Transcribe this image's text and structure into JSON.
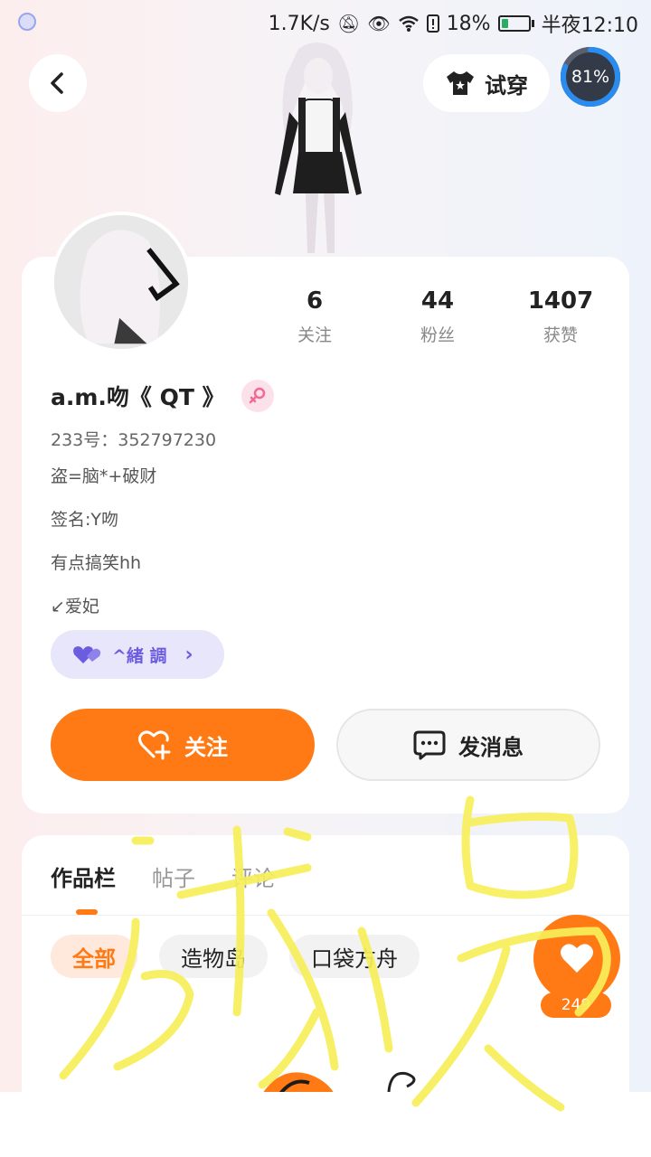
{
  "status_bar": {
    "network_speed": "1.7K/s",
    "battery_percent": "18%",
    "time": "半夜12:10"
  },
  "header": {
    "tryon_label": "试穿",
    "progress_label": "81%",
    "progress_value": 0.81
  },
  "profile": {
    "stats": [
      {
        "value": "6",
        "label": "关注"
      },
      {
        "value": "44",
        "label": "粉丝"
      },
      {
        "value": "1407",
        "label": "获赞"
      }
    ],
    "username": "a.m.吻《 QT 》",
    "account_id": "233号：352797230",
    "bio": [
      "盗=脑*+破财",
      "签名:Y吻",
      "有点搞笑hh",
      "↙爱妃"
    ],
    "tag_label": "^緒 調",
    "follow_label": "关注",
    "message_label": "发消息"
  },
  "content": {
    "tabs": [
      "作品栏",
      "帖子",
      "评论"
    ],
    "active_tab": 0,
    "filters": [
      "全部",
      "造物岛",
      "口袋方舟"
    ],
    "active_filter": 0,
    "like_count": "249"
  },
  "colors": {
    "accent": "#ff7a14",
    "tag": "#6b5ce0",
    "scribble": "#f7ef5a"
  },
  "icons": {
    "back": "chevron-left-icon",
    "tryon": "tshirt-icon",
    "gender": "female-icon",
    "tag": "double-heart-icon",
    "follow": "heart-plus-icon",
    "message": "chat-bubble-icon",
    "like": "heart-icon"
  }
}
